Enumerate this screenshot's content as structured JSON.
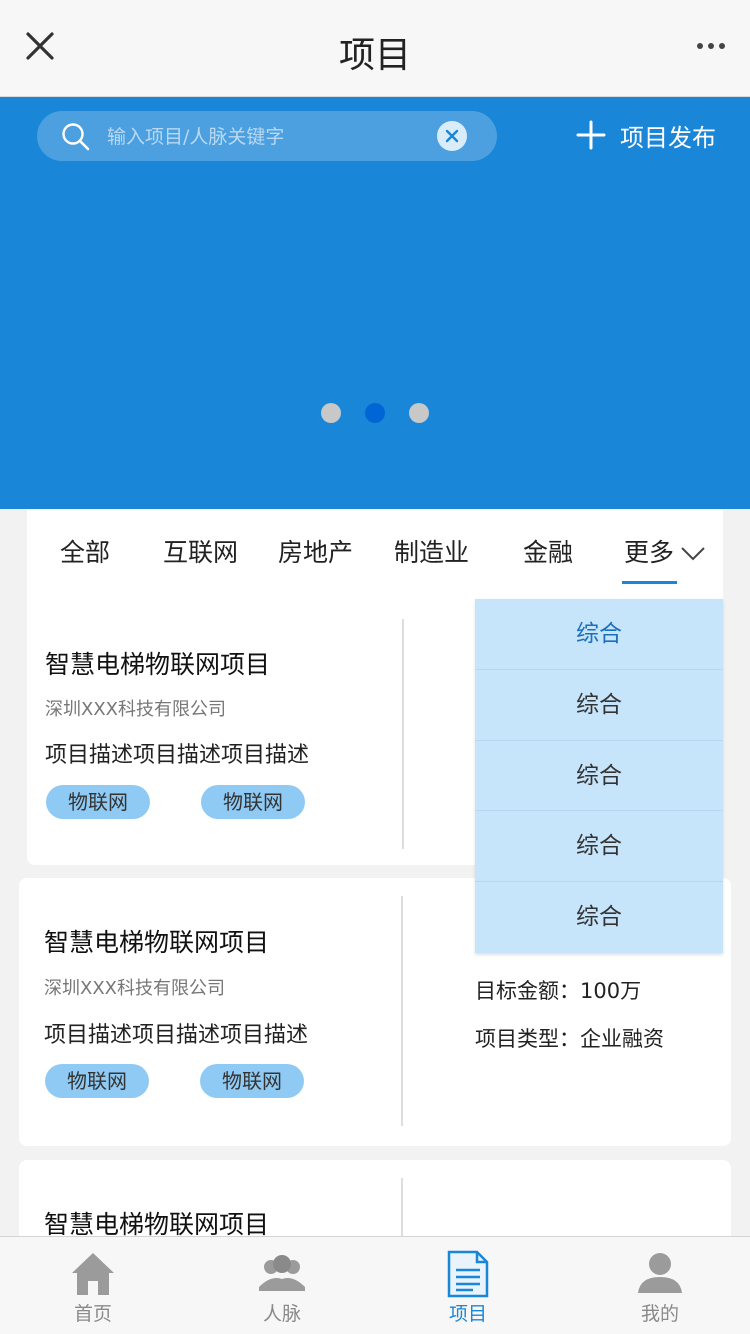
{
  "navbar": {
    "title": "项目"
  },
  "search": {
    "placeholder": "输入项目/人脉关键字"
  },
  "publish": {
    "label": "项目发布"
  },
  "carousel": {
    "count": 3,
    "active_index": 1
  },
  "tabs": [
    "全部",
    "互联网",
    "房地产",
    "制造业",
    "金融",
    "更多"
  ],
  "active_tab": "更多",
  "dropdown": {
    "items": [
      "综合",
      "综合",
      "综合",
      "综合",
      "综合"
    ],
    "selected_index": 0
  },
  "projects": [
    {
      "title": "智慧电梯物联网项目",
      "company": "深圳XXX科技有限公司",
      "description": "项目描述项目描述项目描述",
      "tags": [
        "物联网",
        "物联网"
      ]
    },
    {
      "title": "智慧电梯物联网项目",
      "company": "深圳XXX科技有限公司",
      "description": "项目描述项目描述项目描述",
      "tags": [
        "物联网",
        "物联网"
      ],
      "target_amount_label": "目标金额：100万",
      "project_type_label": "项目类型：企业融资"
    },
    {
      "title": "智慧电梯物联网项目"
    }
  ],
  "tabbar": {
    "items": [
      {
        "label": "首页",
        "icon": "home-icon"
      },
      {
        "label": "人脉",
        "icon": "contacts-icon"
      },
      {
        "label": "项目",
        "icon": "document-icon"
      },
      {
        "label": "我的",
        "icon": "user-icon"
      }
    ],
    "active_index": 2
  },
  "colors": {
    "primary": "#1a86d8",
    "tag_bg": "#8fcaf4",
    "dropdown_bg": "#c7e5fa"
  }
}
